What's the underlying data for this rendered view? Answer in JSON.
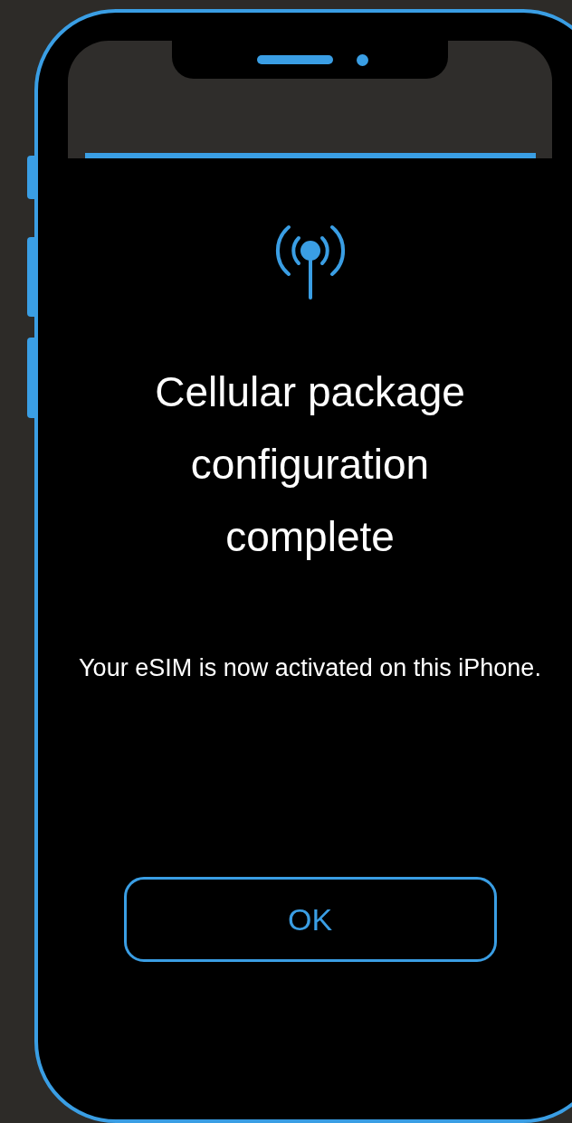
{
  "screen": {
    "title": "Cellular package configuration complete",
    "message": "Your eSIM is now activated on this iPhone.",
    "button": "OK"
  }
}
